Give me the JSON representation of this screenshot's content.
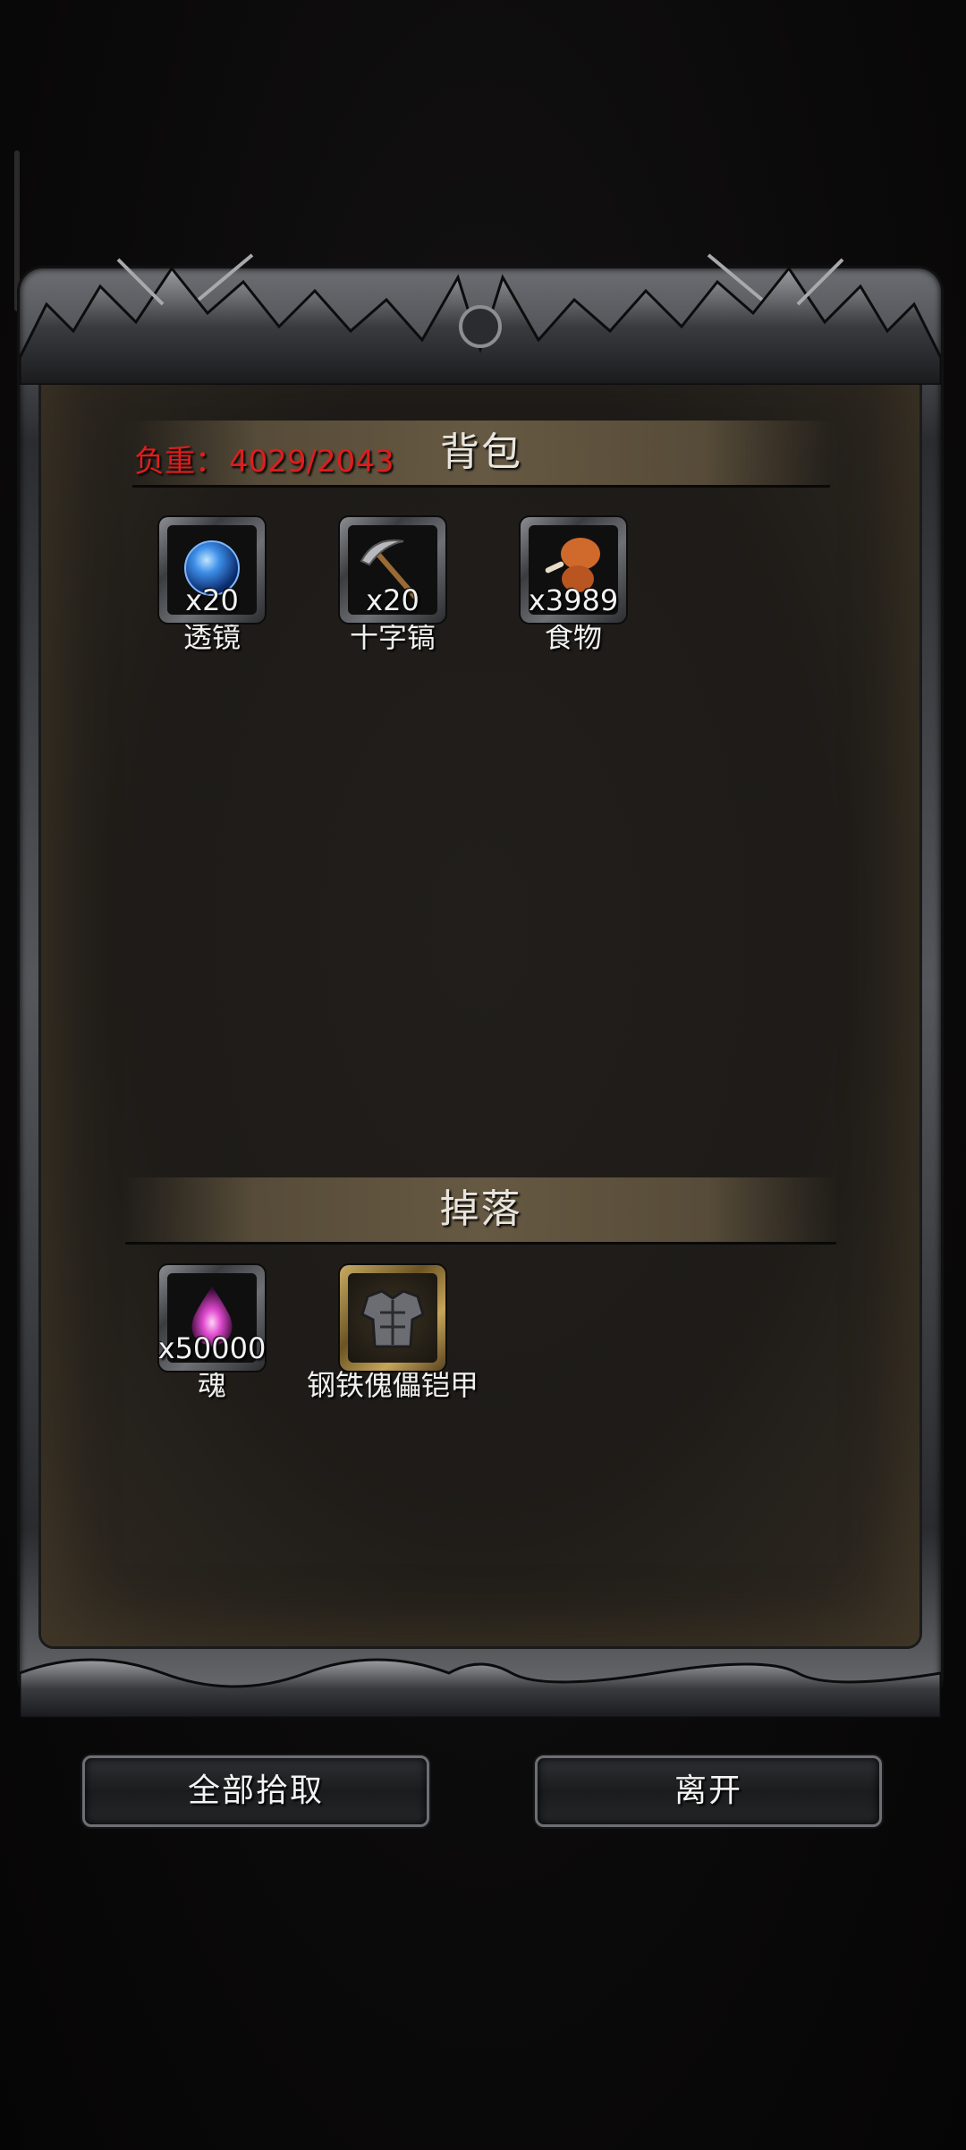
{
  "backpack": {
    "title": "背包",
    "weight_label": "负重：",
    "weight_value": "4029/2043",
    "items": [
      {
        "name": "透镜",
        "qty": "x20",
        "icon": "lens-orb-icon"
      },
      {
        "name": "十字镐",
        "qty": "x20",
        "icon": "pickaxe-icon"
      },
      {
        "name": "食物",
        "qty": "x3989",
        "icon": "meat-drumstick-icon"
      }
    ]
  },
  "drops": {
    "title": "掉落",
    "items": [
      {
        "name": "魂",
        "qty": "x50000",
        "icon": "soul-flame-icon"
      },
      {
        "name": "钢铁傀儡铠甲",
        "qty": "",
        "icon": "iron-armor-icon"
      }
    ]
  },
  "buttons": {
    "pick_all": "全部拾取",
    "leave": "离开"
  },
  "colors": {
    "weight_over": "#e01d1d",
    "frame_metal": "#55575c",
    "panel_bg": "#1e1b18"
  }
}
